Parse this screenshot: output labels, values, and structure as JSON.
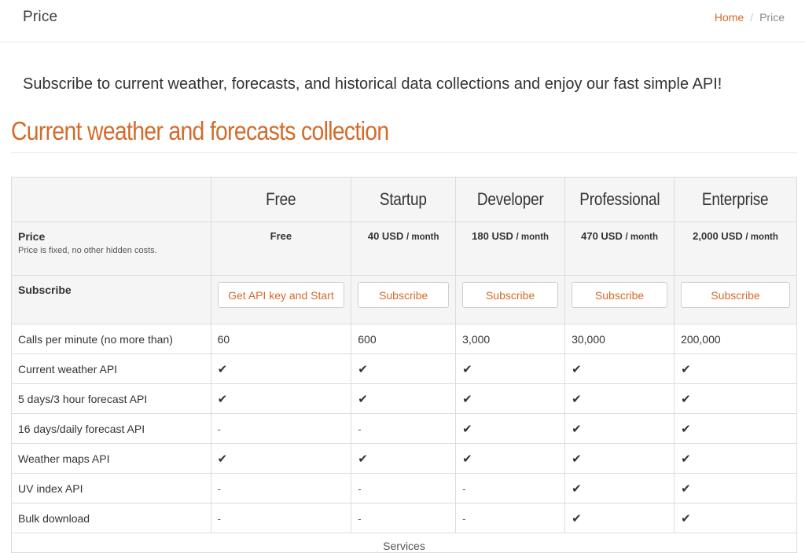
{
  "header": {
    "title": "Price",
    "breadcrumb": {
      "home": "Home",
      "separator": "/",
      "current": "Price"
    }
  },
  "intro": "Subscribe to current weather, forecasts, and historical data collections and enjoy our fast simple API!",
  "section_title": "Current weather and forecasts collection",
  "colors": {
    "accent": "#d26b2b",
    "table_header_bg": "#f5f5f5",
    "border": "#dcdcdc"
  },
  "plans": [
    {
      "name": "Free",
      "price": "Free",
      "unit": "",
      "button": "Get API key and Start",
      "calls": "60",
      "features": [
        "check",
        "check",
        "dash",
        "check",
        "dash",
        "dash"
      ]
    },
    {
      "name": "Startup",
      "price": "40 USD",
      "unit": "/ month",
      "button": "Subscribe",
      "calls": "600",
      "features": [
        "check",
        "check",
        "dash",
        "check",
        "dash",
        "dash"
      ]
    },
    {
      "name": "Developer",
      "price": "180 USD",
      "unit": "/ month",
      "button": "Subscribe",
      "calls": "3,000",
      "features": [
        "check",
        "check",
        "check",
        "check",
        "dash",
        "dash"
      ]
    },
    {
      "name": "Professional",
      "price": "470 USD",
      "unit": "/ month",
      "button": "Subscribe",
      "calls": "30,000",
      "features": [
        "check",
        "check",
        "check",
        "check",
        "check",
        "check"
      ]
    },
    {
      "name": "Enterprise",
      "price": "2,000 USD",
      "unit": "/ month",
      "button": "Subscribe",
      "calls": "200,000",
      "features": [
        "check",
        "check",
        "check",
        "check",
        "check",
        "check"
      ]
    }
  ],
  "rows": {
    "price_label": "Price",
    "price_note": "Price is fixed, no other hidden costs.",
    "subscribe_label": "Subscribe",
    "calls_label": "Calls per minute (no more than)",
    "feature_labels": [
      "Current weather API",
      "5 days/3 hour forecast API",
      "16 days/daily forecast API",
      "Weather maps API",
      "UV index API",
      "Bulk download"
    ],
    "check_symbol": "✔",
    "dash_symbol": "-",
    "more_text": "Services"
  }
}
